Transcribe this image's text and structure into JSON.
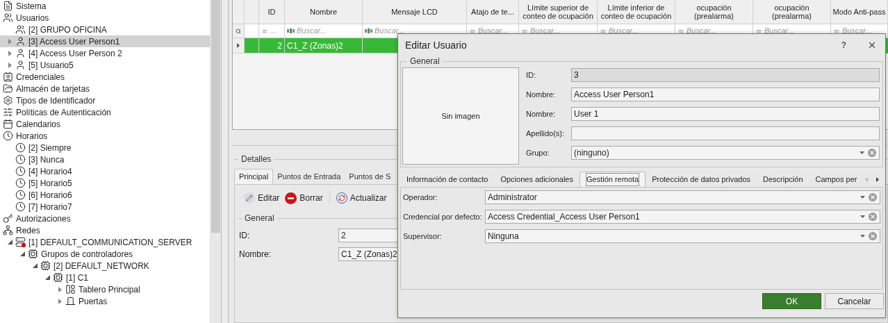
{
  "tree": [
    {
      "label": "Sistema",
      "kind": "system",
      "selected": false
    },
    {
      "label": "Usuarios",
      "kind": "users",
      "selected": false,
      "children": [
        {
          "label": "[2] GRUPO OFICINA",
          "kind": "group",
          "selected": false
        },
        {
          "label": "[3] Access User Person1",
          "kind": "user",
          "selected": true,
          "expanded": false
        },
        {
          "label": "[4] Access User Person 2",
          "kind": "user",
          "selected": false,
          "expanded": false
        },
        {
          "label": "[5] Usuario5",
          "kind": "user",
          "selected": false,
          "expanded": false
        }
      ]
    },
    {
      "label": "Credenciales",
      "kind": "credentials",
      "selected": false
    },
    {
      "label": "Almacén de tarjetas",
      "kind": "cards",
      "selected": false
    },
    {
      "label": "Tipos de Identificador",
      "kind": "id-type",
      "selected": false
    },
    {
      "label": "Políticas de Autenticación",
      "kind": "policy",
      "selected": false
    },
    {
      "label": "Calendarios",
      "kind": "calendar",
      "selected": false
    },
    {
      "label": "Horarios",
      "kind": "schedule",
      "selected": false,
      "children": [
        {
          "label": "[2] Siempre",
          "kind": "schedule",
          "selected": false
        },
        {
          "label": "[3] Nunca",
          "kind": "schedule",
          "selected": false
        },
        {
          "label": "[4] Horario4",
          "kind": "schedule",
          "selected": false
        },
        {
          "label": "[5] Horario5",
          "kind": "schedule",
          "selected": false
        },
        {
          "label": "[6] Horario6",
          "kind": "schedule",
          "selected": false
        },
        {
          "label": "[7] Horario7",
          "kind": "schedule",
          "selected": false
        }
      ]
    },
    {
      "label": "Autorizaciones",
      "kind": "authorization",
      "selected": false
    },
    {
      "label": "Redes",
      "kind": "network",
      "selected": false,
      "children": [
        {
          "label": "[1] DEFAULT_COMMUNICATION_SERVER",
          "kind": "server",
          "selected": false,
          "expanded": true,
          "children": [
            {
              "label": "Grupos de controladores",
              "kind": "controller-group",
              "selected": false,
              "expanded": true,
              "children": [
                {
                  "label": "[2] DEFAULT_NETWORK",
                  "kind": "controller-group",
                  "selected": false,
                  "expanded": true,
                  "children": [
                    {
                      "label": "[1] C1",
                      "kind": "controller",
                      "selected": false,
                      "expanded": true,
                      "children": [
                        {
                          "label": "Tablero Principal",
                          "kind": "panel",
                          "selected": false,
                          "expanded": false
                        },
                        {
                          "label": "Puertas",
                          "kind": "door",
                          "selected": false,
                          "expanded": false
                        }
                      ]
                    }
                  ]
                }
              ]
            }
          ]
        }
      ]
    }
  ],
  "grid": {
    "columns": [
      "ID",
      "Nombre",
      "Mensaje LCD",
      "Atajo de te...",
      "Límite superior de conteo de ocupación",
      "Límite inferior de conteo de ocupación",
      "ocupación (prealarma)",
      "ocupación (prealarma)",
      "Modo Anti-pass"
    ],
    "filters": [
      {
        "kind": "number",
        "placeholder": "..."
      },
      {
        "kind": "text",
        "placeholder": "Buscar..."
      },
      {
        "kind": "text",
        "placeholder": "Buscar..."
      },
      {
        "kind": "number",
        "placeholder": "Buscar..."
      },
      {
        "kind": "number",
        "placeholder": "Buscar..."
      },
      {
        "kind": "number",
        "placeholder": "Buscar..."
      },
      {
        "kind": "number",
        "placeholder": "Buscar..."
      },
      {
        "kind": "number",
        "placeholder": "Buscar..."
      },
      {
        "kind": "number",
        "placeholder": "Buscar..."
      }
    ],
    "rows": [
      {
        "selected": true,
        "cells": [
          "2",
          "C1_Z (Zonas)2"
        ]
      }
    ]
  },
  "details": {
    "title": "Detalles",
    "tabs": [
      {
        "label": "Principal",
        "selected": true
      },
      {
        "label": "Puntos de Entrada",
        "selected": false
      },
      {
        "label": "Puntos de S",
        "selected": false
      }
    ],
    "toolbar": [
      {
        "label": "Editar",
        "kind": "edit"
      },
      {
        "label": "Borrar",
        "kind": "delete"
      },
      {
        "label": "Actualizar",
        "kind": "refresh"
      }
    ],
    "group_title": "General",
    "fields": [
      {
        "label": "ID:",
        "value": "2"
      },
      {
        "label": "Nombre:",
        "value": "C1_Z (Zonas)2"
      }
    ]
  },
  "dialog": {
    "title": "Editar Usuario",
    "help": "?",
    "group_title": "General",
    "photo_text": "Sin imagen",
    "fields": [
      {
        "label": "ID:",
        "value": "3",
        "kind": "readonly"
      },
      {
        "label": "Nombre:",
        "value": "Access User Person1",
        "kind": "text"
      },
      {
        "label": "Nombre:",
        "value": "User 1",
        "kind": "text"
      },
      {
        "label": "Apellido(s):",
        "kind": "text"
      },
      {
        "label": "Grupo:",
        "value": "(ninguno)",
        "kind": "combo"
      }
    ],
    "tabs": [
      {
        "label": "Información de contacto",
        "selected": false
      },
      {
        "label": "Opciones adicionales",
        "selected": false
      },
      {
        "label": "Gestión remota",
        "selected": true
      },
      {
        "label": "Protección de datos privados",
        "selected": false
      },
      {
        "label": "Descripción",
        "selected": false
      },
      {
        "label": "Campos per",
        "selected": false
      }
    ],
    "tab_fields": [
      {
        "label": "Operador:",
        "value": "Administrator",
        "kind": "combo"
      },
      {
        "label": "Credencial por defecto:",
        "value": "Access Credential_Access User Person1",
        "kind": "combo"
      },
      {
        "label": "Supervisor:",
        "value": "Ninguna",
        "kind": "combo"
      }
    ],
    "buttons": [
      {
        "label": "OK",
        "kind": "primary"
      },
      {
        "label": "Cancelar",
        "kind": "secondary"
      }
    ]
  }
}
